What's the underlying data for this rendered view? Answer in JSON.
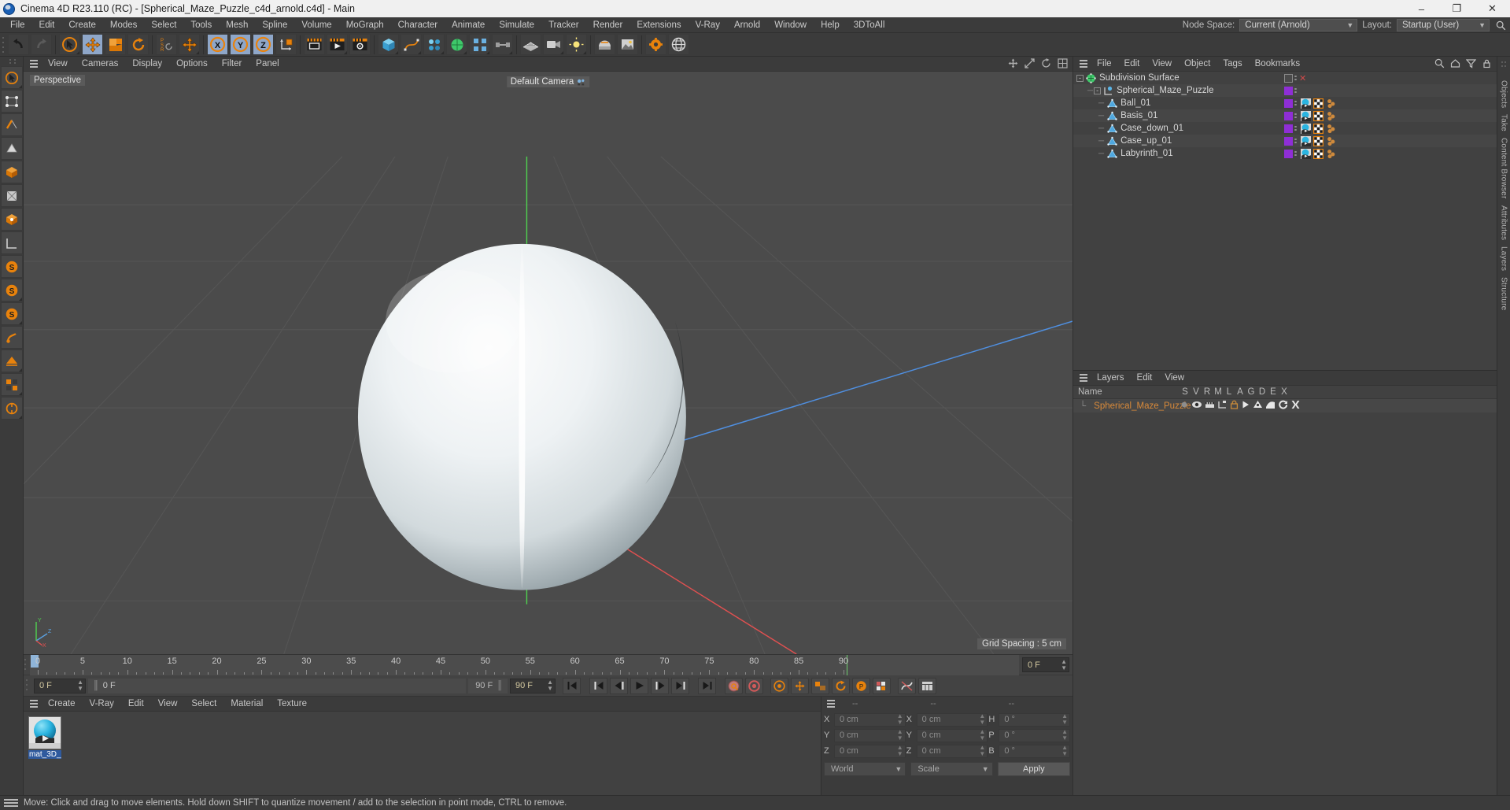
{
  "window": {
    "title": "Cinema 4D R23.110 (RC) - [Spherical_Maze_Puzzle_c4d_arnold.c4d] - Main",
    "minimize": "–",
    "maximize": "❐",
    "close": "✕"
  },
  "menubar": {
    "items": [
      "File",
      "Edit",
      "Create",
      "Modes",
      "Select",
      "Tools",
      "Mesh",
      "Spline",
      "Volume",
      "MoGraph",
      "Character",
      "Animate",
      "Simulate",
      "Tracker",
      "Render",
      "Extensions",
      "V-Ray",
      "Arnold",
      "Window",
      "Help",
      "3DToAll"
    ],
    "node_space_label": "Node Space:",
    "node_space_value": "Current (Arnold)",
    "layout_label": "Layout:",
    "layout_value": "Startup (User)",
    "search_icon": "search-icon"
  },
  "toolbar": {
    "undo": "undo-icon",
    "redo": "redo-icon",
    "select": "select-cursor-icon",
    "move": "move-tool-icon",
    "scale": "scale-tool-icon",
    "rotate": "rotate-tool-icon",
    "psr": "psr-icon",
    "move_world": "move-world-icon",
    "axis_x": "X",
    "axis_y": "Y",
    "axis_z": "Z",
    "axis_world": "world-axis-icon",
    "render_view": "render-view-icon",
    "render_picture": "render-picture-icon",
    "render_settings": "render-settings-icon",
    "cube": "cube-primitive-icon",
    "spline_pen": "spline-pen-icon",
    "array": "array-generator-icon",
    "bend": "bend-deformer-icon",
    "subdivision": "subdivision-surface-icon",
    "mograph": "mograph-icon",
    "scene_nodes": "scene-nodes-icon",
    "floor": "floor-object-icon",
    "camera": "camera-object-icon",
    "light": "light-object-icon",
    "material": "material-icon",
    "texture": "texture-icon",
    "settings_gear": "gear-icon",
    "globe": "globe-icon"
  },
  "leftbar": {
    "items": [
      {
        "name": "live-selection-tool",
        "label": ""
      },
      {
        "name": "point-mode-tool",
        "label": ""
      },
      {
        "name": "edge-mode-tool",
        "label": ""
      },
      {
        "name": "polygon-mode-tool",
        "label": ""
      },
      {
        "name": "model-mode-tool",
        "label": ""
      },
      {
        "name": "texture-mode-tool",
        "label": ""
      },
      {
        "name": "axis-mode-tool",
        "label": ""
      },
      {
        "name": "workplane-tool",
        "label": ""
      },
      {
        "name": "enable-snapping-tool",
        "label": "S"
      },
      {
        "name": "snap-settings-tool",
        "label": "S"
      },
      {
        "name": "quantize-tool",
        "label": "S"
      },
      {
        "name": "lock-axis-tool",
        "label": ""
      },
      {
        "name": "viewport-solo-tool",
        "label": ""
      },
      {
        "name": "display-filter-tool",
        "label": ""
      },
      {
        "name": "layout-tool",
        "label": ""
      }
    ]
  },
  "rightrail": {
    "items": [
      "Objects",
      "Take",
      "Content Browser",
      "Attributes",
      "Layers",
      "Structure"
    ]
  },
  "viewport": {
    "menu": [
      "View",
      "Cameras",
      "Display",
      "Options",
      "Filter",
      "Panel"
    ],
    "perspective_label": "Perspective",
    "camera_label": "Default Camera",
    "grid_spacing": "Grid Spacing : 5 cm",
    "axis_labels": {
      "x": "X",
      "y": "Y",
      "z": "Z"
    },
    "corner_icons": [
      "move-viewport-icon",
      "scale-viewport-icon",
      "rotate-viewport-icon",
      "maximize-viewport-icon"
    ],
    "object_description": "White spherical maze puzzle ball centered in perspective viewport"
  },
  "timeline": {
    "ticks": [
      0,
      5,
      10,
      15,
      20,
      25,
      30,
      35,
      40,
      45,
      50,
      55,
      60,
      65,
      70,
      75,
      80,
      85,
      90
    ],
    "start_frame": "0 F",
    "current_frame": "0 F",
    "end_frame_field": "90 F",
    "preview_end": "90 F",
    "right_frame": "0 F",
    "transport": {
      "goto_start": "goto-start-icon",
      "prev_key": "previous-keyframe-icon",
      "prev_frame": "previous-frame-icon",
      "play": "play-icon",
      "next_frame": "next-frame-icon",
      "next_key": "next-keyframe-icon",
      "goto_end": "goto-end-icon"
    },
    "record_buttons": [
      "record-active-objects-icon",
      "autokeying-icon",
      "keyframe-selection-icon",
      "position-key-icon",
      "scale-key-icon",
      "rotation-key-icon",
      "param-key-icon",
      "point-level-animation-icon"
    ],
    "extra_buttons": [
      "animation-mode-icon",
      "timeline-settings-icon"
    ]
  },
  "material_manager": {
    "menu": [
      "Create",
      "V-Ray",
      "Edit",
      "View",
      "Select",
      "Material",
      "Texture"
    ],
    "materials": [
      {
        "name": "mat_3D_",
        "thumb": "sphere-preview"
      }
    ]
  },
  "coordinates": {
    "headers": [
      "--",
      "--",
      "--"
    ],
    "rows": [
      {
        "pos_label": "X",
        "pos_value": "0 cm",
        "size_label": "X",
        "size_value": "0 cm",
        "rot_label": "H",
        "rot_value": "0 °"
      },
      {
        "pos_label": "Y",
        "pos_value": "0 cm",
        "size_label": "Y",
        "size_value": "0 cm",
        "rot_label": "P",
        "rot_value": "0 °"
      },
      {
        "pos_label": "Z",
        "pos_value": "0 cm",
        "size_label": "Z",
        "size_value": "0 cm",
        "rot_label": "B",
        "rot_value": "0 °"
      }
    ],
    "system": "World",
    "mode": "Scale",
    "apply": "Apply"
  },
  "object_manager": {
    "menu": [
      "File",
      "Edit",
      "View",
      "Object",
      "Tags",
      "Bookmarks"
    ],
    "header_icons": [
      "search-icon",
      "home-icon",
      "filter-icon",
      "lock-icon"
    ],
    "rows": [
      {
        "name": "Subdivision Surface",
        "depth": 0,
        "expander": "-",
        "icon": "subdivision-surface-icon",
        "swatch": null,
        "visible_dots": true,
        "tags": [],
        "cross": true
      },
      {
        "name": "Spherical_Maze_Puzzle",
        "depth": 1,
        "expander": "-",
        "icon": "null-object-icon",
        "swatch": "#8f2ed6",
        "visible_dots": true,
        "tags": []
      },
      {
        "name": "Ball_01",
        "depth": 2,
        "expander": "",
        "icon": "polygon-object-icon",
        "swatch": "#8f2ed6",
        "visible_dots": true,
        "tags": [
          "material-tag",
          "uv-tag",
          "phong-tag"
        ]
      },
      {
        "name": "Basis_01",
        "depth": 2,
        "expander": "",
        "icon": "polygon-object-icon",
        "swatch": "#8f2ed6",
        "visible_dots": true,
        "tags": [
          "material-tag",
          "uv-tag",
          "phong-tag"
        ]
      },
      {
        "name": "Case_down_01",
        "depth": 2,
        "expander": "",
        "icon": "polygon-object-icon",
        "swatch": "#8f2ed6",
        "visible_dots": true,
        "tags": [
          "material-tag",
          "uv-tag",
          "phong-tag"
        ]
      },
      {
        "name": "Case_up_01",
        "depth": 2,
        "expander": "",
        "icon": "polygon-object-icon",
        "swatch": "#8f2ed6",
        "visible_dots": true,
        "tags": [
          "material-tag",
          "uv-tag",
          "phong-tag"
        ]
      },
      {
        "name": "Labyrinth_01",
        "depth": 2,
        "expander": "",
        "icon": "polygon-object-icon",
        "swatch": "#8f2ed6",
        "visible_dots": true,
        "tags": [
          "material-tag",
          "uv-tag",
          "phong-tag"
        ]
      }
    ]
  },
  "layers": {
    "menu": [
      "Layers",
      "Edit",
      "View"
    ],
    "columns": [
      "Name",
      "S",
      "V",
      "R",
      "M",
      "L",
      "A",
      "G",
      "D",
      "E",
      "X"
    ],
    "rows": [
      {
        "name": "Spherical_Maze_Puzzle",
        "color": "#8f2ed6"
      }
    ]
  },
  "status": {
    "text": "Move: Click and drag to move elements. Hold down SHIFT to quantize movement / add to the selection in point mode, CTRL to remove."
  },
  "colors": {
    "accent_orange": "#e8820c",
    "active_blue": "#8fa7c9",
    "layer_purple": "#8f2ed6",
    "panel_bg": "#3b3b3b",
    "list_bg": "#414141",
    "viewport_bg": "#4b4b4b"
  }
}
